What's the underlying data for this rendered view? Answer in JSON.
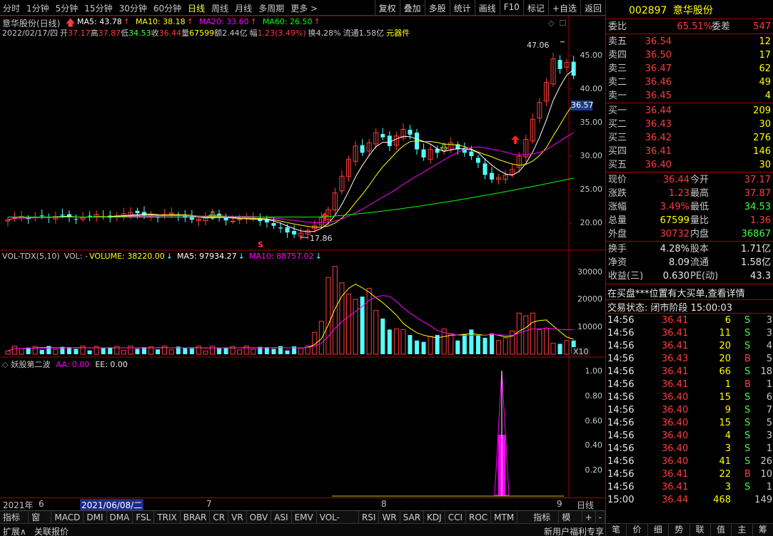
{
  "toolbar": {
    "periods": [
      "分时",
      "1分钟",
      "5分钟",
      "15分钟",
      "30分钟",
      "60分钟",
      "日线",
      "周线",
      "月线",
      "多周期",
      "更多 >"
    ],
    "active_period": "日线",
    "tools": [
      "复权",
      "叠加",
      "多股",
      "统计",
      "画线",
      "F10",
      "标记",
      "+自选",
      "返回"
    ]
  },
  "main_chart": {
    "title": "意华股份(日线)",
    "ma_labels": [
      {
        "text": "MA5: 43.78",
        "color": "#ffffff"
      },
      {
        "text": "MA10: 38.18",
        "color": "#ffff00"
      },
      {
        "text": "MA20: 33.60",
        "color": "#ff00ff"
      },
      {
        "text": "MA60: 26.50",
        "color": "#00ff00"
      }
    ],
    "info_line": {
      "date": "2022/02/17/四",
      "open_label": "开",
      "open": "37.17",
      "high_label": "高",
      "high": "37.87",
      "low_label": "低",
      "low": "34.53",
      "close_label": "收",
      "close": "36.44",
      "vol_label": "量",
      "vol": "67599",
      "amount_label": "额",
      "amount": "2.44亿",
      "chg_label": "幅",
      "chg": "1.23(3.49%)",
      "turnover_label": "换",
      "turnover": "4.28%",
      "float_label": "流通",
      "float": "1.58亿",
      "sector": "元器件"
    },
    "y_ticks": [
      "45.00",
      "40.00",
      "35.00",
      "30.00",
      "25.00",
      "20.00"
    ],
    "current_price_tag": "36.57",
    "high_marker": "47.06",
    "low_marker": "17.86",
    "s_marker": "S"
  },
  "volume_chart": {
    "title": "VOL-TDX(5,10)",
    "vol_label": "VOL: -",
    "volume_label": "VOLUME: 38220.00",
    "ma5_label": "MA5: 97934.27",
    "ma10_label": "MA10: 88757.02",
    "y_ticks": [
      "30000",
      "20000",
      "10000"
    ],
    "unit": "X10"
  },
  "indicator_chart": {
    "title": "妖股第二波",
    "aa_label": "AA: 0.00",
    "ee_label": "EE: 0.00",
    "y_ticks": [
      "1.00",
      "0.80",
      "0.60",
      "0.40",
      "0.20"
    ]
  },
  "date_axis": {
    "labels": [
      "2021年",
      "6",
      "2021/06/08/二",
      "7",
      "8",
      "9"
    ],
    "right_label": "日线"
  },
  "bottom_tabs": [
    "指标A",
    "窗口",
    "MACD",
    "DMI",
    "DMA",
    "FSL",
    "TRIX",
    "BRAR",
    "CR",
    "VR",
    "OBV",
    "ASI",
    "EMV",
    "VOL-TDX",
    "RSI",
    "WR",
    "SAR",
    "KDJ",
    "CCI",
    "ROC",
    "MTM",
    "指标B",
    "模板",
    "+",
    "-"
  ],
  "status_bar": {
    "left1": "扩展∧",
    "left2": "关联报价",
    "right": "新用户福利专享"
  },
  "panel": {
    "code": "002897",
    "name": "意华股份",
    "wei_bi_label": "委比",
    "wei_bi": "65.51%",
    "wei_cha_label": "委差",
    "wei_cha": "547",
    "sells": [
      {
        "label": "卖五",
        "price": "36.54",
        "vol": "12"
      },
      {
        "label": "卖四",
        "price": "36.50",
        "vol": "17"
      },
      {
        "label": "卖三",
        "price": "36.47",
        "vol": "62"
      },
      {
        "label": "卖二",
        "price": "36.46",
        "vol": "49"
      },
      {
        "label": "卖一",
        "price": "36.45",
        "vol": "4"
      }
    ],
    "buys": [
      {
        "label": "买一",
        "price": "36.44",
        "vol": "209"
      },
      {
        "label": "买二",
        "price": "36.43",
        "vol": "30"
      },
      {
        "label": "买三",
        "price": "36.42",
        "vol": "276"
      },
      {
        "label": "买四",
        "price": "36.41",
        "vol": "146"
      },
      {
        "label": "买五",
        "price": "36.40",
        "vol": "30"
      }
    ],
    "stats": [
      {
        "k1": "现价",
        "v1": "36.44",
        "c1": "red",
        "k2": "今开",
        "v2": "37.17",
        "c2": "red"
      },
      {
        "k1": "涨跌",
        "v1": "1.23",
        "c1": "red",
        "k2": "最高",
        "v2": "37.87",
        "c2": "red"
      },
      {
        "k1": "涨幅",
        "v1": "3.49%",
        "c1": "red",
        "k2": "最低",
        "v2": "34.53",
        "c2": "green"
      },
      {
        "k1": "总量",
        "v1": "67599",
        "c1": "yellow",
        "k2": "量比",
        "v2": "1.36",
        "c2": "red"
      },
      {
        "k1": "外盘",
        "v1": "30732",
        "c1": "red",
        "k2": "内盘",
        "v2": "36867",
        "c2": "green"
      }
    ],
    "stats2": [
      {
        "k1": "换手",
        "v1": "4.28%",
        "c1": "white",
        "k2": "股本",
        "v2": "1.71亿",
        "c2": "white"
      },
      {
        "k1": "净资",
        "v1": "8.09",
        "c1": "white",
        "k2": "流通",
        "v2": "1.58亿",
        "c2": "white"
      },
      {
        "k1": "收益(三)",
        "v1": "0.630",
        "c1": "white",
        "k2": "PE(动)",
        "v2": "43.3",
        "c2": "white"
      }
    ],
    "notice": "在买盘***位置有大买单,查看详情",
    "trade_status": "交易状态: 闭市阶段 15:00:03",
    "ticks": [
      {
        "t": "14:56",
        "p": "36.41",
        "v": "6",
        "d": "S",
        "n": "3"
      },
      {
        "t": "14:56",
        "p": "36.41",
        "v": "11",
        "d": "S",
        "n": "3"
      },
      {
        "t": "14:56",
        "p": "36.41",
        "v": "20",
        "d": "S",
        "n": "4"
      },
      {
        "t": "14:56",
        "p": "36.43",
        "v": "20",
        "d": "B",
        "n": "5"
      },
      {
        "t": "14:56",
        "p": "36.41",
        "v": "66",
        "d": "S",
        "n": "18"
      },
      {
        "t": "14:56",
        "p": "36.41",
        "v": "1",
        "d": "B",
        "n": "1"
      },
      {
        "t": "14:56",
        "p": "36.40",
        "v": "15",
        "d": "S",
        "n": "6"
      },
      {
        "t": "14:56",
        "p": "36.40",
        "v": "9",
        "d": "S",
        "n": "7"
      },
      {
        "t": "14:56",
        "p": "36.40",
        "v": "15",
        "d": "S",
        "n": "5"
      },
      {
        "t": "14:56",
        "p": "36.40",
        "v": "4",
        "d": "S",
        "n": "3"
      },
      {
        "t": "14:56",
        "p": "36.40",
        "v": "3",
        "d": "S",
        "n": "1"
      },
      {
        "t": "14:56",
        "p": "36.40",
        "v": "41",
        "d": "S",
        "n": "26"
      },
      {
        "t": "14:56",
        "p": "36.41",
        "v": "22",
        "d": "B",
        "n": "10"
      },
      {
        "t": "14:56",
        "p": "36.41",
        "v": "3",
        "d": "S",
        "n": "1"
      },
      {
        "t": "15:00",
        "p": "36.44",
        "v": "468",
        "d": "",
        "n": "149"
      }
    ],
    "bottom_tabs": [
      "笔",
      "价",
      "细",
      "势",
      "联",
      "值",
      "主",
      "筹"
    ]
  },
  "colors": {
    "up": "#ff3c3c",
    "down": "#54ffff",
    "ma5": "#ffffff",
    "ma10": "#ffff00",
    "ma20": "#ff00ff",
    "ma60": "#00ff00",
    "border": "#a00000"
  }
}
